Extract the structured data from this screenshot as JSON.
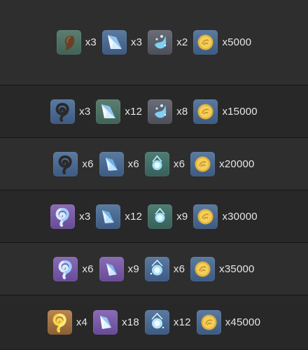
{
  "rows": [
    {
      "quantities": [
        "x3",
        "x3",
        "x2",
        "x5000"
      ],
      "icons": [
        "gold-chip-icon",
        "crystal-shard-icon",
        "sparkle-orb-icon",
        "mora-coin-icon"
      ]
    },
    {
      "quantities": [
        "x3",
        "x12",
        "x8",
        "x15000"
      ],
      "icons": [
        "spiral-shell-icon",
        "crystal-shard-icon",
        "sparkle-orb-icon",
        "mora-coin-icon"
      ]
    },
    {
      "quantities": [
        "x6",
        "x6",
        "x6",
        "x20000"
      ],
      "icons": [
        "spiral-shell-icon",
        "crystal-shard-icon",
        "sparkle-orb-icon",
        "mora-coin-icon"
      ]
    },
    {
      "quantities": [
        "x3",
        "x12",
        "x9",
        "x30000"
      ],
      "icons": [
        "spiral-shell-icon",
        "crystal-shard-icon",
        "sparkle-orb-icon",
        "mora-coin-icon"
      ]
    },
    {
      "quantities": [
        "x6",
        "x9",
        "x6",
        "x35000"
      ],
      "icons": [
        "spiral-shell-icon",
        "crystal-shard-icon",
        "sparkle-orb-icon",
        "mora-coin-icon"
      ]
    },
    {
      "quantities": [
        "x4",
        "x18",
        "x12",
        "x45000"
      ],
      "icons": [
        "spiral-shell-icon",
        "crystal-shard-icon",
        "sparkle-orb-icon",
        "mora-coin-icon"
      ]
    }
  ],
  "colors": {
    "background": "#232323",
    "row_light": "#2e2e2e",
    "row_dark": "#282828",
    "text": "#e6e6e6"
  }
}
